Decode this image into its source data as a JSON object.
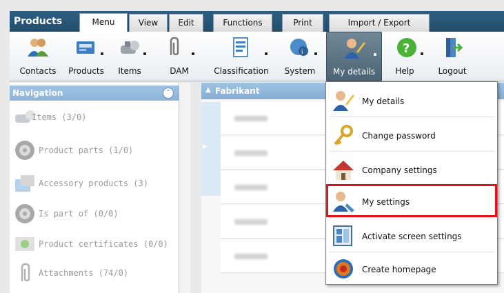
{
  "app": {
    "title": "Products"
  },
  "tabs": [
    {
      "label": "Menu",
      "active": true
    },
    {
      "label": "View"
    },
    {
      "label": "Edit"
    },
    {
      "label": "Functions"
    },
    {
      "label": "Print"
    },
    {
      "label": "Import / Export"
    }
  ],
  "toolbar": {
    "items": [
      {
        "label": "Contacts",
        "icon": "contacts-icon"
      },
      {
        "label": "Products",
        "icon": "products-icon"
      },
      {
        "label": "Items",
        "icon": "items-icon"
      },
      {
        "label": "DAM",
        "icon": "paperclip-icon"
      },
      {
        "label": "Classification",
        "icon": "classification-icon"
      },
      {
        "label": "System",
        "icon": "system-icon"
      },
      {
        "label": "My details",
        "icon": "user-edit-icon",
        "pressed": true
      },
      {
        "label": "Help",
        "icon": "help-icon"
      },
      {
        "label": "Logout",
        "icon": "logout-icon"
      }
    ]
  },
  "navigation": {
    "title": "Navigation",
    "items": [
      {
        "label": "Items (3/0)",
        "icon": "items-icon"
      },
      {
        "label": "Product parts (1/0)",
        "icon": "wheel-icon"
      },
      {
        "label": "Accessory products (3)",
        "icon": "accessory-icon"
      },
      {
        "label": "Is part of (0/0)",
        "icon": "wheel-icon"
      },
      {
        "label": "Product certificates (0/0)",
        "icon": "certificate-icon"
      },
      {
        "label": "Attachments (74/0)",
        "icon": "paperclip-icon"
      }
    ]
  },
  "grid": {
    "column": "Fabrikant"
  },
  "menu": {
    "items": [
      {
        "label": "My details",
        "icon": "user-edit-icon"
      },
      {
        "label": "Change password",
        "icon": "key-icon"
      },
      {
        "label": "Company settings",
        "icon": "company-icon"
      },
      {
        "label": "My settings",
        "icon": "user-settings-icon",
        "highlighted": true
      },
      {
        "label": "Activate screen settings",
        "icon": "screen-settings-icon"
      },
      {
        "label": "Create homepage",
        "icon": "homepage-icon"
      }
    ]
  },
  "colors": {
    "header": "#2d5f83",
    "panel_header": "#9fc3e3",
    "highlight": "#e3121b"
  }
}
